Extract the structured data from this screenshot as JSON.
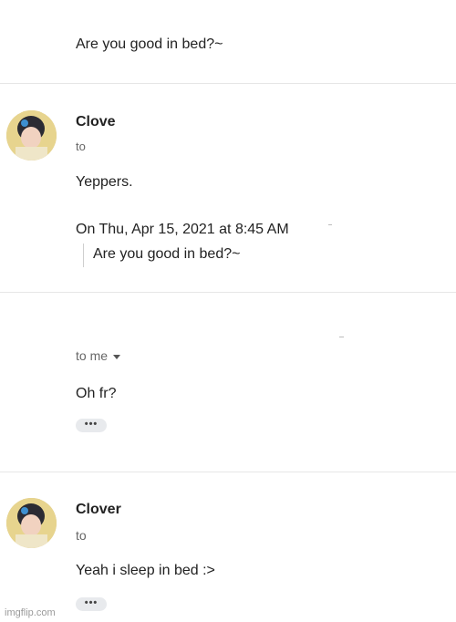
{
  "thread": {
    "top_quote": "Are you good in bed?~",
    "messages": [
      {
        "sender": "Clove",
        "to": "to",
        "body": "Yeppers.",
        "quoted_header": "On Thu, Apr 15, 2021 at 8:45 AM",
        "quoted_text": "Are you good in bed?~"
      },
      {
        "sender": "",
        "to": "to me",
        "body": "Oh fr?",
        "more_label": "•••"
      },
      {
        "sender": "Clover",
        "to": "to",
        "body": "Yeah i sleep in bed :>",
        "more_label": "•••"
      }
    ]
  },
  "watermark": "imgflip.com",
  "colors": {
    "divider": "#e6e6e6",
    "pill": "#e8eaed",
    "muted": "#666666"
  }
}
